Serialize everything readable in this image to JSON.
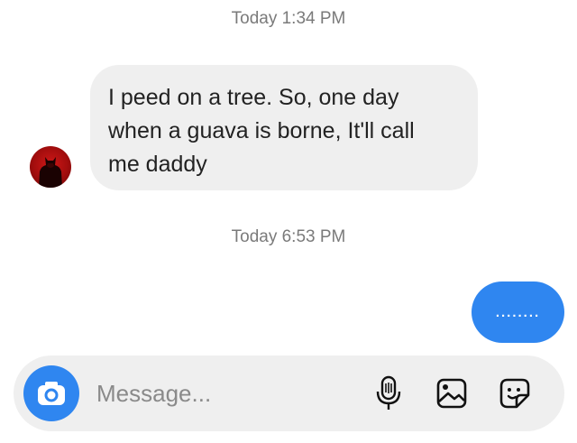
{
  "thread": {
    "timestamp_1": "Today 1:34 PM",
    "incoming_message": {
      "line_1": "I peed on a tree. So, one day",
      "line_2": "when a guava is borne, It'll call",
      "line_3": "me daddy"
    },
    "timestamp_2": "Today 6:53 PM",
    "outgoing_message": "........"
  },
  "composer": {
    "placeholder": "Message..."
  },
  "icons": {
    "avatar": "batman-avatar",
    "camera": "camera-icon",
    "mic": "microphone-icon",
    "gallery": "image-gallery-icon",
    "sticker": "sticker-icon"
  },
  "colors": {
    "accent_blue": "#2f86f0",
    "bubble_gray": "#efefef",
    "timestamp_gray": "#7a7a7a"
  }
}
